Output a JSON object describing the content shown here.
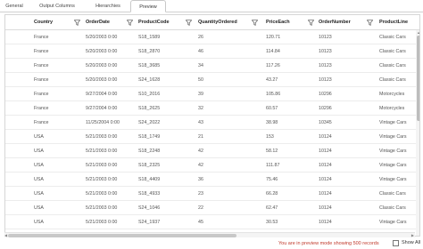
{
  "tabs": [
    {
      "label": "General"
    },
    {
      "label": "Output Columns"
    },
    {
      "label": "Hierarchies"
    },
    {
      "label": "Preview"
    }
  ],
  "columns": [
    {
      "label": "Country"
    },
    {
      "label": "OrderDate"
    },
    {
      "label": "ProductCode"
    },
    {
      "label": "QuantityOrdered"
    },
    {
      "label": "PriceEach"
    },
    {
      "label": "OrderNumber"
    },
    {
      "label": "ProductLine"
    }
  ],
  "rows": [
    [
      "France",
      "5/20/2003 0:00",
      "S18_1589",
      "26",
      "120.71",
      "10123",
      "Classic Cars"
    ],
    [
      "France",
      "5/20/2003 0:00",
      "S18_2870",
      "46",
      "114.84",
      "10123",
      "Classic Cars"
    ],
    [
      "France",
      "5/20/2003 0:00",
      "S18_3685",
      "34",
      "117.26",
      "10123",
      "Classic Cars"
    ],
    [
      "France",
      "5/20/2003 0:00",
      "S24_1628",
      "50",
      "43.27",
      "10123",
      "Classic Cars"
    ],
    [
      "France",
      "9/27/2004 0:00",
      "S10_2016",
      "39",
      "105.86",
      "10296",
      "Motorcycles"
    ],
    [
      "France",
      "9/27/2004 0:00",
      "S18_2625",
      "32",
      "60.57",
      "10296",
      "Motorcycles"
    ],
    [
      "France",
      "11/25/2004 0:00",
      "S24_2022",
      "43",
      "38.98",
      "10345",
      "Vintage Cars"
    ],
    [
      "USA",
      "5/21/2003 0:00",
      "S18_1749",
      "21",
      "153",
      "10124",
      "Vintage Cars"
    ],
    [
      "USA",
      "5/21/2003 0:00",
      "S18_2248",
      "42",
      "58.12",
      "10124",
      "Vintage Cars"
    ],
    [
      "USA",
      "5/21/2003 0:00",
      "S18_2325",
      "42",
      "111.87",
      "10124",
      "Vintage Cars"
    ],
    [
      "USA",
      "5/21/2003 0:00",
      "S18_4409",
      "36",
      "75.46",
      "10124",
      "Vintage Cars"
    ],
    [
      "USA",
      "5/21/2003 0:00",
      "S18_4933",
      "23",
      "66.28",
      "10124",
      "Classic Cars"
    ],
    [
      "USA",
      "5/21/2003 0:00",
      "S24_1046",
      "22",
      "62.47",
      "10124",
      "Classic Cars"
    ],
    [
      "USA",
      "5/21/2003 0:00",
      "S24_1937",
      "45",
      "30.53",
      "10124",
      "Vintage Cars"
    ]
  ],
  "status": {
    "message": "You are in preview mode showing 500 records"
  },
  "show_all": {
    "label": "Show All",
    "checked": false
  },
  "colors": {
    "status_text": "#c0392b",
    "border": "#d6d6d6",
    "header_text": "#222222"
  }
}
